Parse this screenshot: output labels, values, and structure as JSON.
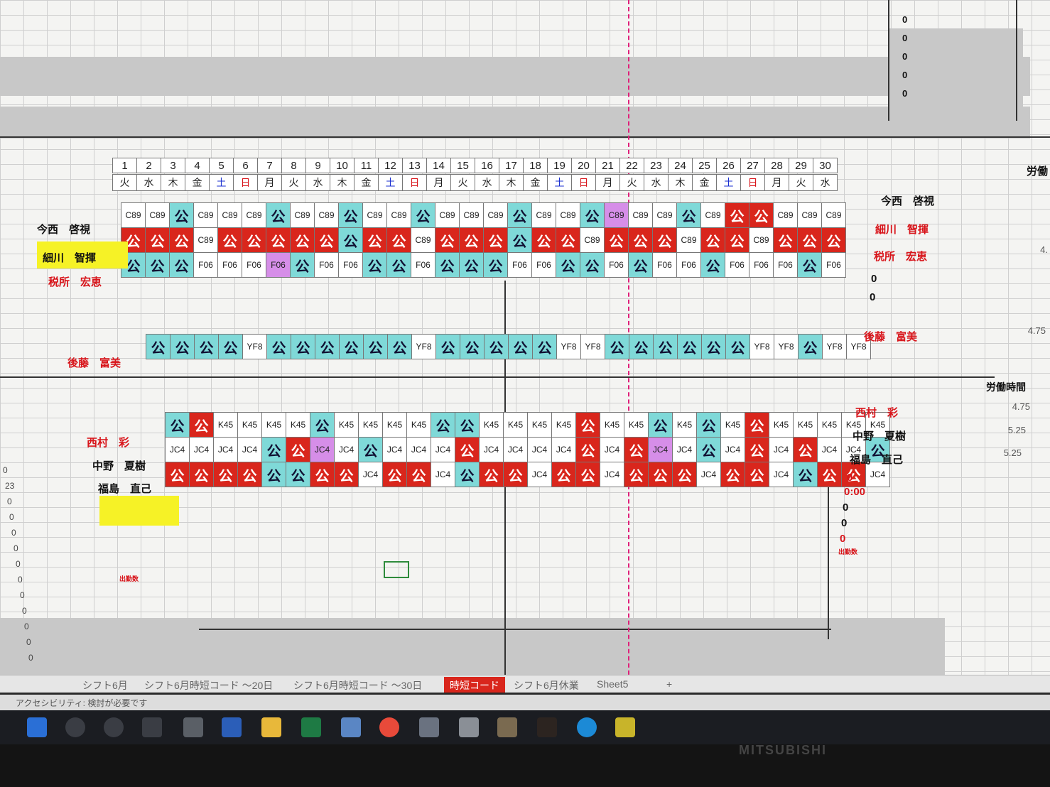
{
  "tabs": [
    "シフト6月",
    "シフト6月時短コード ～20日",
    "シフト6月時短コード ～30日",
    "時短コード",
    "シフト6月休業",
    "Sheet5",
    "+"
  ],
  "active_tab": "時短コード",
  "status": "アクセシビリティ: 検討が必要です",
  "monitor_brand": "MITSUBISHI",
  "days": [
    "1",
    "2",
    "3",
    "4",
    "5",
    "6",
    "7",
    "8",
    "9",
    "10",
    "11",
    "12",
    "13",
    "14",
    "15",
    "16",
    "17",
    "18",
    "19",
    "20",
    "21",
    "22",
    "23",
    "24",
    "25",
    "26",
    "27",
    "28",
    "29",
    "30"
  ],
  "weekdays": [
    "火",
    "水",
    "木",
    "金",
    "土",
    "日",
    "月",
    "火",
    "水",
    "木",
    "金",
    "土",
    "日",
    "月",
    "火",
    "水",
    "木",
    "金",
    "土",
    "日",
    "月",
    "火",
    "水",
    "木",
    "金",
    "土",
    "日",
    "月",
    "火",
    "水"
  ],
  "top_names_left": [
    "今西　啓視",
    "細川　智揮",
    "税所　宏恵"
  ],
  "top_names_right": [
    "今西　啓視",
    "細川　智揮",
    "税所　宏恵"
  ],
  "goto_name": "後藤　富美",
  "bottom_names_left": [
    "西村　彩",
    "中野　夏樹",
    "福島　直己"
  ],
  "bottom_names_right": [
    "西村　彩",
    "中野　夏樹",
    "福島　直己"
  ],
  "top_zeros": [
    "0",
    "0",
    "0",
    "0",
    "0"
  ],
  "right_zero_a": "0",
  "right_zero_b": "0",
  "time_zero": "0:00",
  "attend_label": "出勤数",
  "labor_hours": "労働時間",
  "labor_head": "労働",
  "val_a": "4.",
  "val_b": "4.75",
  "val_c": "4.75",
  "val_d": "5.25",
  "val_e": "5.25",
  "top_rows": [
    [
      "C89",
      "C89",
      "公",
      "C89",
      "C89",
      "C89",
      "公",
      "C89",
      "C89",
      "公",
      "C89",
      "C89",
      "公",
      "C89",
      "C89",
      "C89",
      "公",
      "C89",
      "C89",
      "公",
      "C89",
      "C89",
      "C89",
      "公",
      "C89",
      "公",
      "公",
      "C89",
      "C89",
      "C89"
    ],
    [
      "公",
      "公",
      "公",
      "C89",
      "公",
      "公",
      "公",
      "公",
      "公",
      "公",
      "公",
      "公",
      "C89",
      "公",
      "公",
      "公",
      "公",
      "公",
      "公",
      "C89",
      "公",
      "公",
      "公",
      "C89",
      "公",
      "公",
      "C89",
      "公",
      "公",
      "公"
    ],
    [
      "公",
      "公",
      "公",
      "F06",
      "F06",
      "F06",
      "F06",
      "公",
      "F06",
      "F06",
      "公",
      "公",
      "F06",
      "公",
      "公",
      "公",
      "F06",
      "F06",
      "公",
      "公",
      "F06",
      "公",
      "F06",
      "F06",
      "公",
      "F06",
      "F06",
      "F06",
      "公",
      "F06"
    ]
  ],
  "top_colors": [
    [
      "w",
      "w",
      "k",
      "w",
      "w",
      "w",
      "k",
      "w",
      "w",
      "k",
      "w",
      "w",
      "k",
      "w",
      "w",
      "w",
      "k",
      "w",
      "w",
      "k",
      "p",
      "w",
      "w",
      "k",
      "w",
      "r",
      "r",
      "w",
      "w",
      "w"
    ],
    [
      "r",
      "r",
      "r",
      "w",
      "r",
      "r",
      "r",
      "r",
      "r",
      "k",
      "r",
      "r",
      "w",
      "r",
      "r",
      "r",
      "k",
      "r",
      "r",
      "w",
      "r",
      "r",
      "r",
      "w",
      "r",
      "r",
      "w",
      "r",
      "r",
      "r"
    ],
    [
      "k",
      "k",
      "k",
      "w",
      "w",
      "w",
      "p",
      "k",
      "w",
      "w",
      "k",
      "k",
      "w",
      "k",
      "k",
      "k",
      "w",
      "w",
      "k",
      "k",
      "w",
      "k",
      "w",
      "w",
      "k",
      "w",
      "w",
      "w",
      "k",
      "w"
    ]
  ],
  "goto_row": [
    "公",
    "公",
    "公",
    "公",
    "YF8",
    "公",
    "公",
    "公",
    "公",
    "公",
    "公",
    "YF8",
    "公",
    "公",
    "公",
    "公",
    "公",
    "YF8",
    "YF8",
    "公",
    "公",
    "公",
    "公",
    "公",
    "公",
    "YF8",
    "YF8",
    "公",
    "YF8",
    "YF8"
  ],
  "goto_colors": [
    "k",
    "k",
    "k",
    "k",
    "w",
    "k",
    "k",
    "k",
    "k",
    "k",
    "k",
    "w",
    "k",
    "k",
    "k",
    "k",
    "k",
    "w",
    "w",
    "k",
    "k",
    "k",
    "k",
    "k",
    "k",
    "w",
    "w",
    "k",
    "w",
    "w"
  ],
  "bot_rows": [
    [
      "公",
      "公",
      "K45",
      "K45",
      "K45",
      "K45",
      "公",
      "K45",
      "K45",
      "K45",
      "K45",
      "公",
      "公",
      "K45",
      "K45",
      "K45",
      "K45",
      "公",
      "K45",
      "K45",
      "公",
      "K45",
      "公",
      "K45",
      "公",
      "K45",
      "K45",
      "K45",
      "K45",
      "K45"
    ],
    [
      "JC4",
      "JC4",
      "JC4",
      "JC4",
      "公",
      "公",
      "JC4",
      "JC4",
      "公",
      "JC4",
      "JC4",
      "JC4",
      "公",
      "JC4",
      "JC4",
      "JC4",
      "JC4",
      "公",
      "JC4",
      "公",
      "JC4",
      "JC4",
      "公",
      "JC4",
      "公",
      "JC4",
      "公",
      "JC4",
      "JC4",
      "公"
    ],
    [
      "公",
      "公",
      "公",
      "公",
      "公",
      "公",
      "公",
      "公",
      "JC4",
      "公",
      "公",
      "JC4",
      "公",
      "公",
      "公",
      "JC4",
      "公",
      "公",
      "JC4",
      "公",
      "公",
      "公",
      "JC4",
      "公",
      "公",
      "JC4",
      "公",
      "公",
      "公",
      "JC4"
    ]
  ],
  "bot_colors": [
    [
      "k",
      "r",
      "w",
      "w",
      "w",
      "w",
      "k",
      "w",
      "w",
      "w",
      "w",
      "k",
      "k",
      "w",
      "w",
      "w",
      "w",
      "r",
      "w",
      "w",
      "k",
      "w",
      "k",
      "w",
      "r",
      "w",
      "w",
      "w",
      "w",
      "w"
    ],
    [
      "w",
      "w",
      "w",
      "w",
      "k",
      "r",
      "p",
      "w",
      "k",
      "w",
      "w",
      "w",
      "r",
      "w",
      "w",
      "w",
      "w",
      "r",
      "w",
      "r",
      "p",
      "w",
      "k",
      "w",
      "r",
      "w",
      "r",
      "w",
      "w",
      "k"
    ],
    [
      "r",
      "r",
      "r",
      "r",
      "k",
      "k",
      "r",
      "r",
      "w",
      "r",
      "r",
      "w",
      "k",
      "r",
      "r",
      "w",
      "r",
      "r",
      "w",
      "r",
      "r",
      "r",
      "w",
      "r",
      "r",
      "w",
      "k",
      "r",
      "r",
      "w"
    ]
  ],
  "left_numbers": [
    "0",
    "23",
    "0",
    "0",
    "0",
    "0",
    "0",
    "0",
    "0",
    "0",
    "0",
    "0",
    "0"
  ]
}
